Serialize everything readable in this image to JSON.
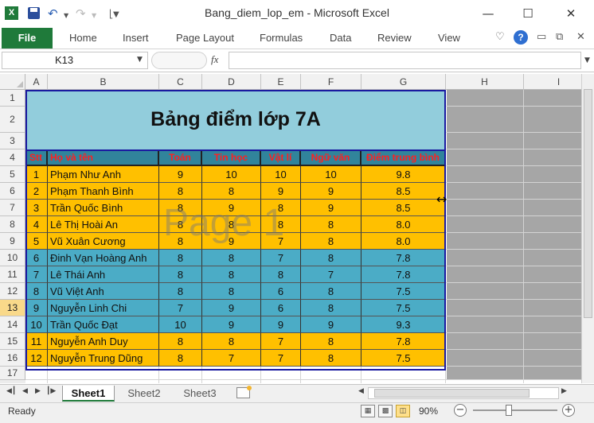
{
  "window": {
    "title": "Bang_diem_lop_em  -  Microsoft Excel"
  },
  "ribbon": {
    "file": "File",
    "tabs": [
      "Home",
      "Insert",
      "Page Layout",
      "Formulas",
      "Data",
      "Review",
      "View"
    ]
  },
  "formula_bar": {
    "name_box": "K13",
    "fx": "fx",
    "value": ""
  },
  "columns": [
    "A",
    "B",
    "C",
    "D",
    "E",
    "F",
    "G",
    "H",
    "I"
  ],
  "rows": [
    "1",
    "2",
    "3",
    "4",
    "5",
    "6",
    "7",
    "8",
    "9",
    "10",
    "11",
    "12",
    "13",
    "14",
    "15",
    "16",
    "17"
  ],
  "selected_row": "13",
  "sheet_title": "Bảng điểm lớp 7A",
  "table": {
    "headers": [
      "Stt",
      "Họ và tên",
      "Toán",
      "Tin học",
      "Vật lí",
      "Ngữ văn",
      "Điểm trung bình"
    ],
    "rows": [
      [
        "1",
        "Phạm Như Anh",
        "9",
        "10",
        "10",
        "10",
        "9.8"
      ],
      [
        "2",
        "Phạm Thanh Bình",
        "8",
        "8",
        "9",
        "9",
        "8.5"
      ],
      [
        "3",
        "Trần Quốc Bình",
        "8",
        "9",
        "8",
        "9",
        "8.5"
      ],
      [
        "4",
        "Lê Thị Hoài An",
        "8",
        "8",
        "8",
        "8",
        "8.0"
      ],
      [
        "5",
        "Vũ Xuân Cương",
        "8",
        "9",
        "7",
        "8",
        "8.0"
      ],
      [
        "6",
        "Đinh Vạn Hoàng Anh",
        "8",
        "8",
        "7",
        "8",
        "7.8"
      ],
      [
        "7",
        "Lê Thái Anh",
        "8",
        "8",
        "8",
        "7",
        "7.8"
      ],
      [
        "8",
        "Vũ Việt Anh",
        "8",
        "8",
        "6",
        "8",
        "7.5"
      ],
      [
        "9",
        "Nguyễn Linh Chi",
        "7",
        "9",
        "6",
        "8",
        "7.5"
      ],
      [
        "10",
        "Trần Quốc Đạt",
        "10",
        "9",
        "9",
        "9",
        "9.3"
      ],
      [
        "11",
        "Nguyễn Anh Duy",
        "8",
        "8",
        "7",
        "8",
        "7.8"
      ],
      [
        "12",
        "Nguyễn Trung Dũng",
        "8",
        "7",
        "7",
        "8",
        "7.5"
      ]
    ]
  },
  "watermark": "Page 1",
  "sheet_tabs": [
    "Sheet1",
    "Sheet2",
    "Sheet3"
  ],
  "active_sheet": "Sheet1",
  "status": {
    "ready": "Ready",
    "zoom": "90%"
  },
  "colors": {
    "file_tab": "#1f7a3a",
    "header_fill": "#31849b",
    "header_text": "#ff2020",
    "row_yellow": "#ffc000",
    "row_blue": "#4bacc6",
    "title_fill": "#92cddc",
    "border": "#1a1aa0"
  },
  "icons": [
    "excel-logo-icon",
    "save-icon",
    "undo-icon",
    "redo-icon",
    "customize-qat-icon",
    "minimize-icon",
    "maximize-icon",
    "close-icon",
    "help-icon",
    "function-icon",
    "new-sheet-icon"
  ]
}
